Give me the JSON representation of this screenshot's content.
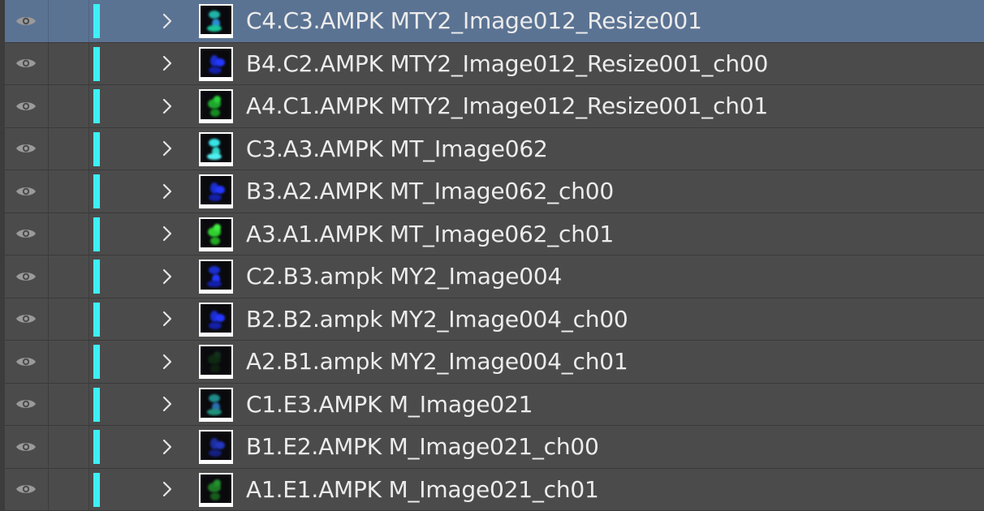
{
  "layers": [
    {
      "name": "C4.C3.AMPK MTY2_Image012_Resize001",
      "selected": true,
      "thumb": "cyan"
    },
    {
      "name": "B4.C2.AMPK MTY2_Image012_Resize001_ch00",
      "selected": false,
      "thumb": "blue"
    },
    {
      "name": "A4.C1.AMPK MTY2_Image012_Resize001_ch01",
      "selected": false,
      "thumb": "green"
    },
    {
      "name": "C3.A3.AMPK MT_Image062",
      "selected": false,
      "thumb": "cyan-bright"
    },
    {
      "name": "B3.A2.AMPK MT_Image062_ch00",
      "selected": false,
      "thumb": "blue"
    },
    {
      "name": "A3.A1.AMPK MT_Image062_ch01",
      "selected": false,
      "thumb": "green-bright"
    },
    {
      "name": "C2.B3.ampk MY2_Image004",
      "selected": false,
      "thumb": "blue"
    },
    {
      "name": "B2.B2.ampk MY2_Image004_ch00",
      "selected": false,
      "thumb": "blue"
    },
    {
      "name": "A2.B1.ampk MY2_Image004_ch01",
      "selected": false,
      "thumb": "dark"
    },
    {
      "name": "C1.E3.AMPK M_Image021",
      "selected": false,
      "thumb": "teal"
    },
    {
      "name": "B1.E2.AMPK M_Image021_ch00",
      "selected": false,
      "thumb": "blue-dim"
    },
    {
      "name": "A1.E1.AMPK M_Image021_ch01",
      "selected": false,
      "thumb": "green-dim"
    }
  ],
  "icons": {
    "visibility": "eye-icon",
    "expand": "chevron-right-icon",
    "layer_color_tag": "cyan"
  },
  "colors": {
    "selected_row": "#5b7393",
    "panel_bg": "#4b4b4b",
    "layer_tag": "#3ef0f6"
  }
}
